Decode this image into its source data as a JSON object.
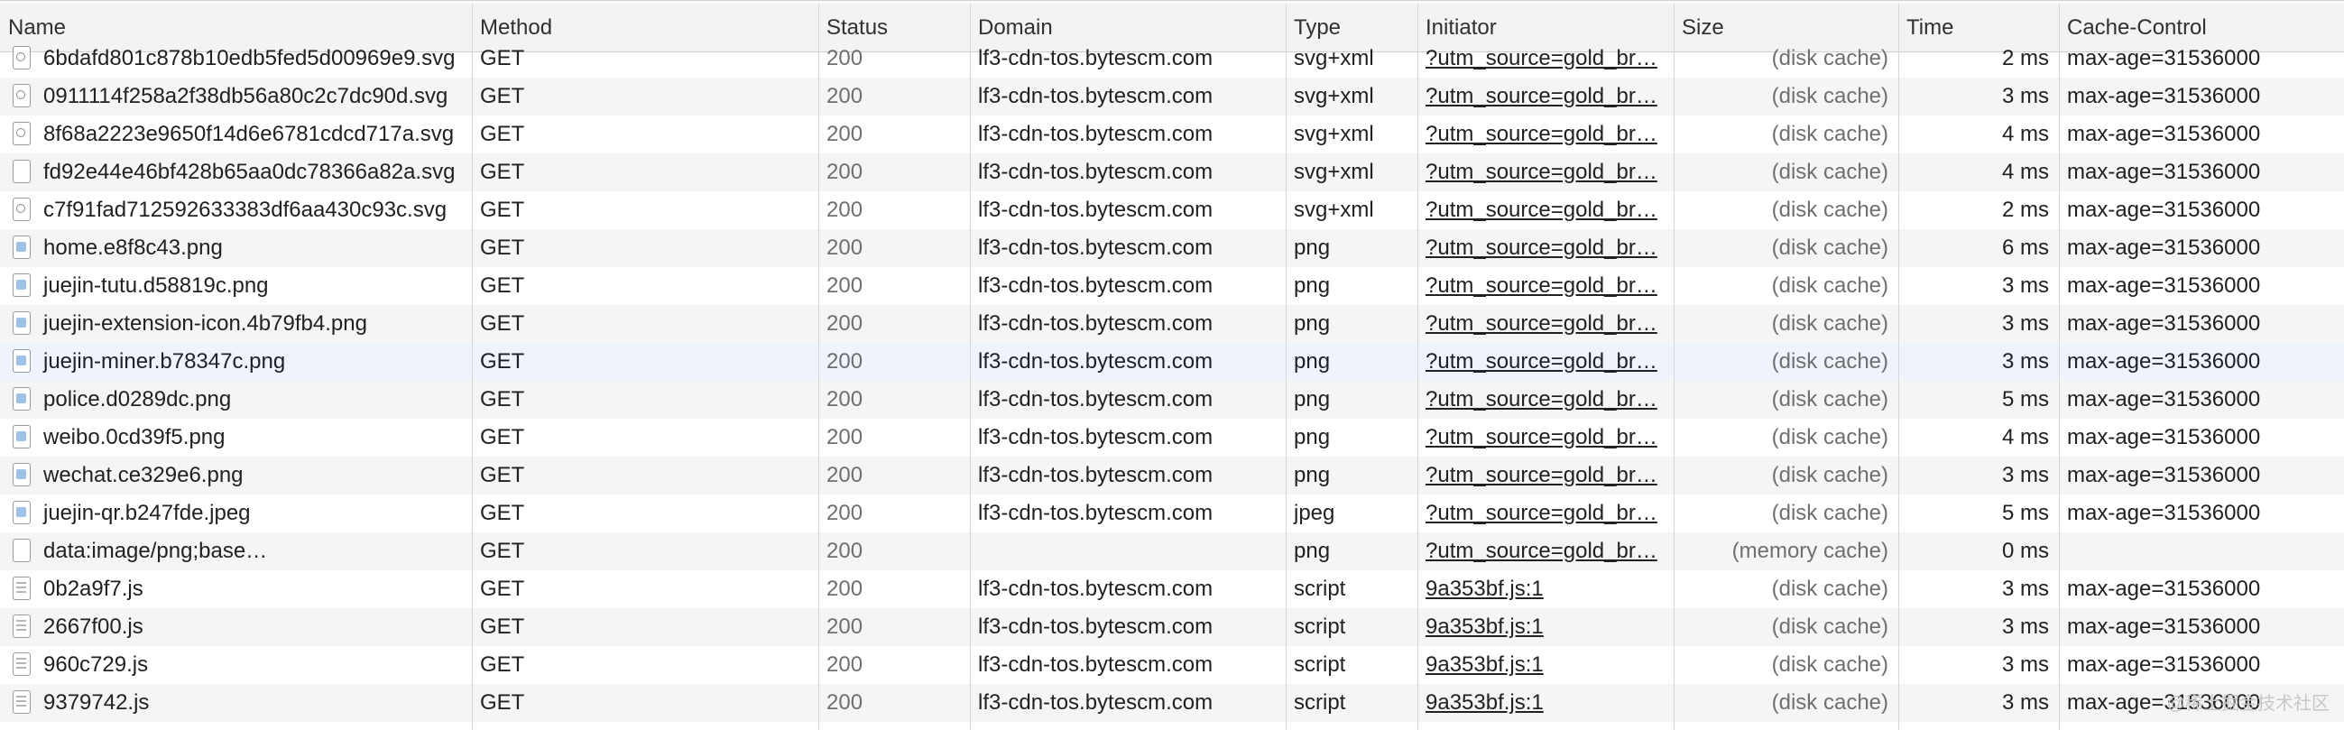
{
  "columns": {
    "name": "Name",
    "method": "Method",
    "status": "Status",
    "domain": "Domain",
    "type": "Type",
    "initiator": "Initiator",
    "size": "Size",
    "time": "Time",
    "cache": "Cache-Control"
  },
  "rows": [
    {
      "name": "6bdafd801c878b10edb5fed5d00969e9.svg",
      "method": "GET",
      "status": "200",
      "domain": "lf3-cdn-tos.bytescm.com",
      "type": "svg+xml",
      "initiator": "?utm_source=gold_br…",
      "size": "(disk cache)",
      "time": "2 ms",
      "cache": "max-age=31536000",
      "icon": "svg-file-icon"
    },
    {
      "name": "0911114f258a2f38db56a80c2c7dc90d.svg",
      "method": "GET",
      "status": "200",
      "domain": "lf3-cdn-tos.bytescm.com",
      "type": "svg+xml",
      "initiator": "?utm_source=gold_br…",
      "size": "(disk cache)",
      "time": "3 ms",
      "cache": "max-age=31536000",
      "icon": "svg-file-icon"
    },
    {
      "name": "8f68a2223e9650f14d6e6781cdcd717a.svg",
      "method": "GET",
      "status": "200",
      "domain": "lf3-cdn-tos.bytescm.com",
      "type": "svg+xml",
      "initiator": "?utm_source=gold_br…",
      "size": "(disk cache)",
      "time": "4 ms",
      "cache": "max-age=31536000",
      "icon": "svg-file-icon"
    },
    {
      "name": "fd92e44e46bf428b65aa0dc78366a82a.svg",
      "method": "GET",
      "status": "200",
      "domain": "lf3-cdn-tos.bytescm.com",
      "type": "svg+xml",
      "initiator": "?utm_source=gold_br…",
      "size": "(disk cache)",
      "time": "4 ms",
      "cache": "max-age=31536000",
      "icon": "blank-file-icon"
    },
    {
      "name": "c7f91fad712592633383df6aa430c93c.svg",
      "method": "GET",
      "status": "200",
      "domain": "lf3-cdn-tos.bytescm.com",
      "type": "svg+xml",
      "initiator": "?utm_source=gold_br…",
      "size": "(disk cache)",
      "time": "2 ms",
      "cache": "max-age=31536000",
      "icon": "svg-file-icon"
    },
    {
      "name": "home.e8f8c43.png",
      "method": "GET",
      "status": "200",
      "domain": "lf3-cdn-tos.bytescm.com",
      "type": "png",
      "initiator": "?utm_source=gold_br…",
      "size": "(disk cache)",
      "time": "6 ms",
      "cache": "max-age=31536000",
      "icon": "image-file-icon"
    },
    {
      "name": "juejin-tutu.d58819c.png",
      "method": "GET",
      "status": "200",
      "domain": "lf3-cdn-tos.bytescm.com",
      "type": "png",
      "initiator": "?utm_source=gold_br…",
      "size": "(disk cache)",
      "time": "3 ms",
      "cache": "max-age=31536000",
      "icon": "image-file-icon"
    },
    {
      "name": "juejin-extension-icon.4b79fb4.png",
      "method": "GET",
      "status": "200",
      "domain": "lf3-cdn-tos.bytescm.com",
      "type": "png",
      "initiator": "?utm_source=gold_br…",
      "size": "(disk cache)",
      "time": "3 ms",
      "cache": "max-age=31536000",
      "icon": "image-file-icon"
    },
    {
      "name": "juejin-miner.b78347c.png",
      "method": "GET",
      "status": "200",
      "domain": "lf3-cdn-tos.bytescm.com",
      "type": "png",
      "initiator": "?utm_source=gold_br…",
      "size": "(disk cache)",
      "time": "3 ms",
      "cache": "max-age=31536000",
      "icon": "image-file-icon"
    },
    {
      "name": "police.d0289dc.png",
      "method": "GET",
      "status": "200",
      "domain": "lf3-cdn-tos.bytescm.com",
      "type": "png",
      "initiator": "?utm_source=gold_br…",
      "size": "(disk cache)",
      "time": "5 ms",
      "cache": "max-age=31536000",
      "icon": "image-file-icon"
    },
    {
      "name": "weibo.0cd39f5.png",
      "method": "GET",
      "status": "200",
      "domain": "lf3-cdn-tos.bytescm.com",
      "type": "png",
      "initiator": "?utm_source=gold_br…",
      "size": "(disk cache)",
      "time": "4 ms",
      "cache": "max-age=31536000",
      "icon": "image-file-icon"
    },
    {
      "name": "wechat.ce329e6.png",
      "method": "GET",
      "status": "200",
      "domain": "lf3-cdn-tos.bytescm.com",
      "type": "png",
      "initiator": "?utm_source=gold_br…",
      "size": "(disk cache)",
      "time": "3 ms",
      "cache": "max-age=31536000",
      "icon": "image-file-icon"
    },
    {
      "name": "juejin-qr.b247fde.jpeg",
      "method": "GET",
      "status": "200",
      "domain": "lf3-cdn-tos.bytescm.com",
      "type": "jpeg",
      "initiator": "?utm_source=gold_br…",
      "size": "(disk cache)",
      "time": "5 ms",
      "cache": "max-age=31536000",
      "icon": "image-file-icon"
    },
    {
      "name": "data:image/png;base…",
      "method": "GET",
      "status": "200",
      "domain": "",
      "type": "png",
      "initiator": "?utm_source=gold_br…",
      "size": "(memory cache)",
      "time": "0 ms",
      "cache": "",
      "icon": "blank-file-icon"
    },
    {
      "name": "0b2a9f7.js",
      "method": "GET",
      "status": "200",
      "domain": "lf3-cdn-tos.bytescm.com",
      "type": "script",
      "initiator": "9a353bf.js:1",
      "size": "(disk cache)",
      "time": "3 ms",
      "cache": "max-age=31536000",
      "icon": "script-file-icon"
    },
    {
      "name": "2667f00.js",
      "method": "GET",
      "status": "200",
      "domain": "lf3-cdn-tos.bytescm.com",
      "type": "script",
      "initiator": "9a353bf.js:1",
      "size": "(disk cache)",
      "time": "3 ms",
      "cache": "max-age=31536000",
      "icon": "script-file-icon"
    },
    {
      "name": "960c729.js",
      "method": "GET",
      "status": "200",
      "domain": "lf3-cdn-tos.bytescm.com",
      "type": "script",
      "initiator": "9a353bf.js:1",
      "size": "(disk cache)",
      "time": "3 ms",
      "cache": "max-age=31536000",
      "icon": "script-file-icon"
    },
    {
      "name": "9379742.js",
      "method": "GET",
      "status": "200",
      "domain": "lf3-cdn-tos.bytescm.com",
      "type": "script",
      "initiator": "9a353bf.js:1",
      "size": "(disk cache)",
      "time": "3 ms",
      "cache": "max-age=31536000",
      "icon": "script-file-icon"
    }
  ],
  "selected_row": 8,
  "watermark": "@稀土掘金技术社区"
}
